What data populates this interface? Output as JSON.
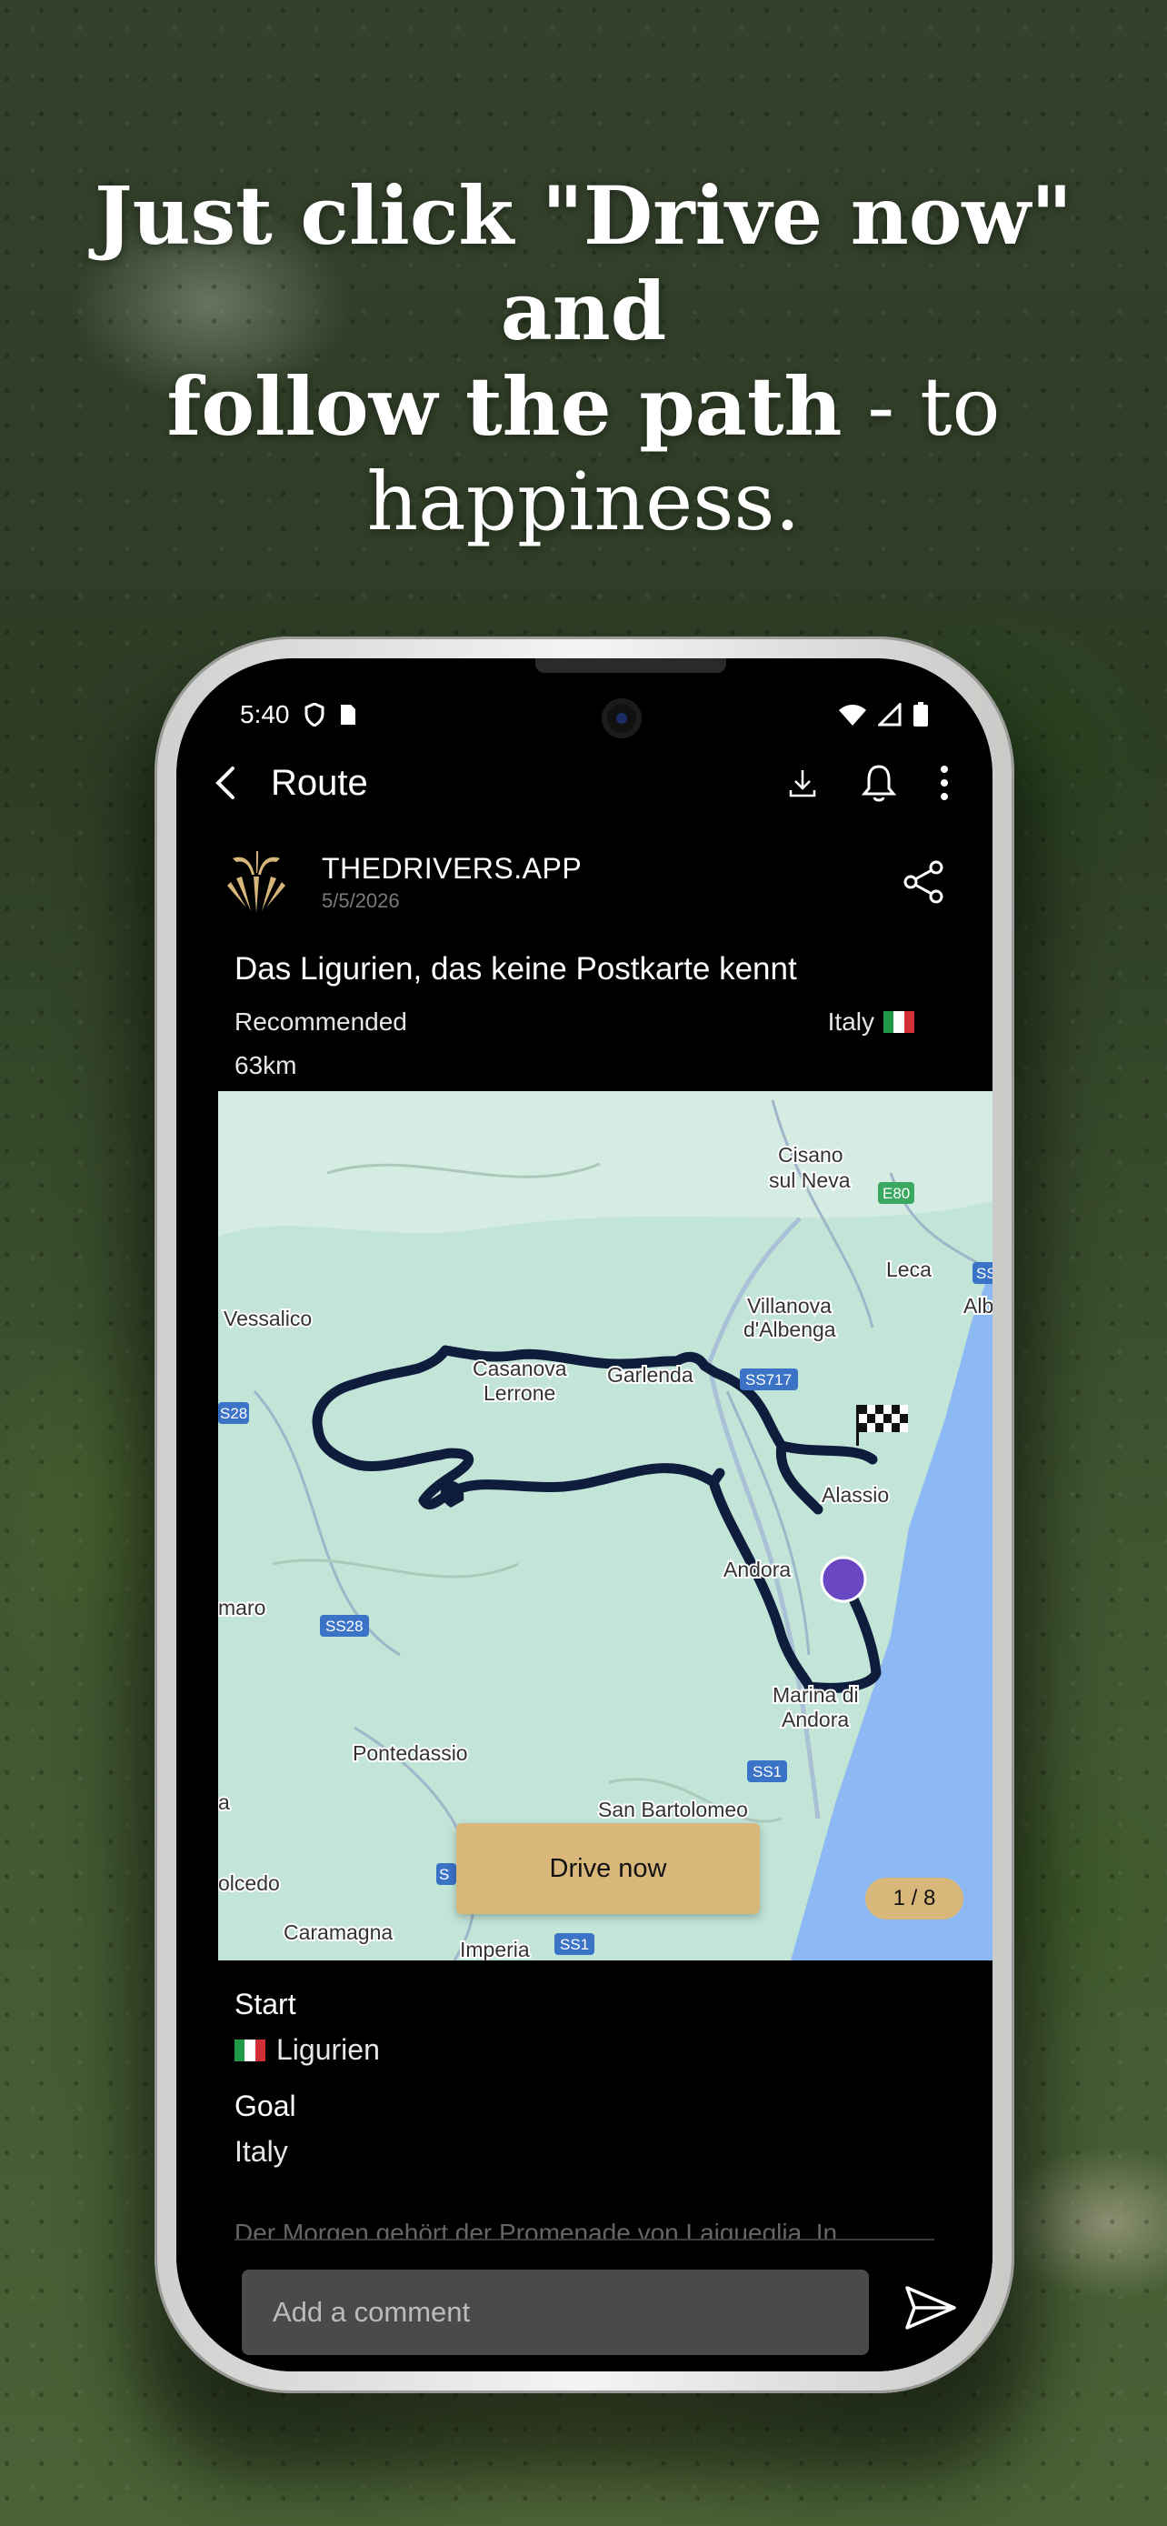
{
  "headline": {
    "line1": "Just click \"Drive now\" and",
    "line2_bold": "follow the path",
    "line2_thin": " - to",
    "line3": "happiness."
  },
  "status_bar": {
    "time": "5:40"
  },
  "app_bar": {
    "title": "Route"
  },
  "author": {
    "name": "THEDRIVERS.APP",
    "date": "5/5/2026"
  },
  "route": {
    "title": "Das Ligurien, das keine Postkarte kennt",
    "tag": "Recommended",
    "country": "Italy",
    "distance": "63km"
  },
  "map": {
    "labels": {
      "cisano": "Cisano",
      "sul_neva": "sul Neva",
      "e80": "E80",
      "leca": "Leca",
      "vessalico": "Vessalico",
      "villanova": "Villanova",
      "albenga": "d'Albenga",
      "alb": "Alb",
      "ss1_top": "SS",
      "casanova": "Casanova",
      "lerrone": "Lerrone",
      "garlenda": "Garlenda",
      "ss717": "SS717",
      "s28": "S28",
      "alassio": "Alassio",
      "andora": "Andora",
      "maro": "maro",
      "ss28": "SS28",
      "marina": "Marina di",
      "andora2": "Andora",
      "pontedassio": "Pontedassio",
      "a": "a",
      "ss1_mid": "SS1",
      "san_bartolomeo": "San Bartolomeo",
      "olcedo": "olcedo",
      "s_small": "S",
      "caramagna": "Caramagna",
      "imperia": "Imperia",
      "ss1_bottom": "SS1"
    },
    "drive_button": "Drive now",
    "counter": "1 / 8"
  },
  "start": {
    "label": "Start",
    "value": "Ligurien"
  },
  "goal": {
    "label": "Goal",
    "value": "Italy"
  },
  "description_preview": "Der Morgen gehört der Promenade von Laigueglia. In",
  "comment": {
    "placeholder": "Add a comment"
  },
  "colors": {
    "accent": "#d9b77a",
    "route_line": "#0f1d3d",
    "position_dot": "#6a48c4",
    "sea": "#8cb8f4"
  }
}
